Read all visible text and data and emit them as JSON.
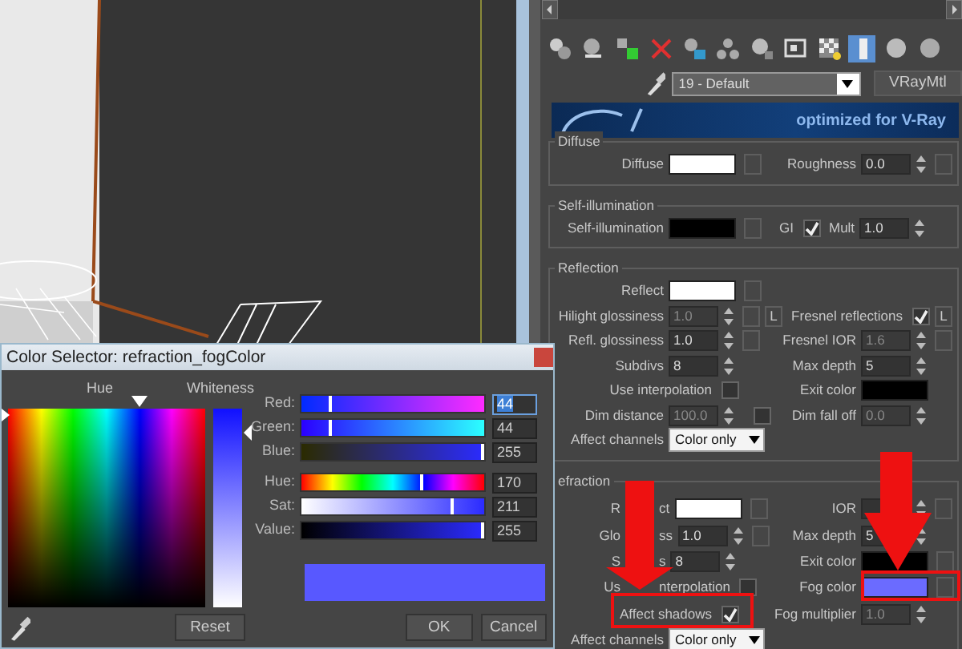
{
  "material_editor": {
    "toolbar": [
      {
        "active": false
      },
      {
        "active": false
      },
      {
        "active": false
      },
      {
        "active": false
      },
      {
        "active": false
      },
      {
        "active": false
      },
      {
        "active": false
      },
      {
        "active": false
      },
      {
        "active": false
      },
      {
        "active": true
      },
      {
        "active": false
      },
      {
        "active": false
      }
    ],
    "material_name": "19 - Default",
    "material_type": "VRayMtl",
    "banner_text": "optimized for V-Ray",
    "groups": [
      {
        "title": "Diffuse",
        "rows": [
          {
            "left": [
              {
                "label": "Diffuse",
                "kind": "color",
                "color": "#ffffff",
                "map": true
              }
            ],
            "right": [
              {
                "label": "Roughness",
                "kind": "spinner",
                "value": "0.0",
                "map": true,
                "disabled": false
              }
            ]
          }
        ]
      },
      {
        "title": "Self-illumination",
        "rows": [
          {
            "left": [
              {
                "label": "Self-illumination",
                "kind": "color",
                "color": "#000000",
                "map": true
              }
            ],
            "right": [
              {
                "label": "GI",
                "kind": "check",
                "checked": true
              },
              {
                "label": "Mult",
                "kind": "spinner",
                "value": "1.0",
                "map": false,
                "disabled": false
              }
            ]
          }
        ]
      },
      {
        "title": "Reflection",
        "rows": [
          {
            "left": [
              {
                "label": "Reflect",
                "kind": "color",
                "color": "#ffffff",
                "map": true
              }
            ],
            "right": []
          },
          {
            "left": [
              {
                "label": "Hilight glossiness",
                "kind": "spinner",
                "value": "1.0",
                "map": true,
                "lock": "L",
                "disabled": true
              }
            ],
            "right": [
              {
                "label": "Fresnel reflections",
                "kind": "check",
                "checked": true,
                "lock": "L"
              }
            ]
          },
          {
            "left": [
              {
                "label": "Refl. glossiness",
                "kind": "spinner",
                "value": "1.0",
                "map": true,
                "disabled": false
              }
            ],
            "right": [
              {
                "label": "Fresnel IOR",
                "kind": "spinner",
                "value": "1.6",
                "map": true,
                "disabled": true
              }
            ]
          },
          {
            "left": [
              {
                "label": "Subdivs",
                "kind": "spinner",
                "value": "8",
                "map": false,
                "disabled": false
              }
            ],
            "right": [
              {
                "label": "Max depth",
                "kind": "spinner",
                "value": "5",
                "map": false,
                "disabled": false
              }
            ]
          },
          {
            "left": [
              {
                "label": "Use interpolation",
                "kind": "check",
                "checked": false
              }
            ],
            "right": [
              {
                "label": "Exit color",
                "kind": "color",
                "color": "#000000",
                "map": false
              }
            ]
          },
          {
            "left": [
              {
                "label": "Dim distance",
                "kind": "spinner",
                "value": "100.0",
                "map": false,
                "disabled": true
              },
              {
                "kind": "check",
                "checked": false
              }
            ],
            "right": [
              {
                "label": "Dim fall off",
                "kind": "spinner",
                "value": "0.0",
                "map": false,
                "disabled": true
              }
            ]
          },
          {
            "left": [
              {
                "label": "Affect channels",
                "kind": "dropdown",
                "value": "Color only"
              }
            ],
            "right": []
          }
        ]
      },
      {
        "title": "efraction",
        "rows": [
          {
            "left": [
              {
                "label": [
                  "R",
                  "ct"
                ],
                "kind": "color",
                "color": "#ffffff",
                "map": true
              }
            ],
            "right": [
              {
                "label": "IOR",
                "kind": "spinner",
                "map": true
              }
            ]
          },
          {
            "left": [
              {
                "label": [
                  "Glo",
                  "ss"
                ],
                "kind": "spinner",
                "value": "1.0",
                "map": true,
                "disabled": false
              }
            ],
            "right": [
              {
                "label": "Max depth",
                "kind": "spinner",
                "value": "5",
                "map": false,
                "disabled": false
              }
            ]
          },
          {
            "left": [
              {
                "label": [
                  "S",
                  "s"
                ],
                "kind": "spinner",
                "value": "8",
                "map": false,
                "disabled": false
              }
            ],
            "right": [
              {
                "label": "Exit color",
                "kind": "color",
                "color": "#000000",
                "map": true
              }
            ]
          },
          {
            "left": [
              {
                "label": [
                  "Us",
                  "nterpolation"
                ],
                "kind": "check",
                "checked": false
              }
            ],
            "right": [
              {
                "label": "Fog color",
                "kind": "color",
                "color": "#6b6bff",
                "map": true
              }
            ]
          },
          {
            "left": [
              {
                "label": "Affect shadows",
                "kind": "check",
                "checked": true
              }
            ],
            "right": [
              {
                "label": "Fog multiplier",
                "kind": "spinner",
                "value": "1.0",
                "map": false,
                "disabled": true
              }
            ]
          },
          {
            "left": [
              {
                "label": "Affect channels",
                "kind": "dropdown",
                "value": "Color only"
              }
            ],
            "right": []
          }
        ]
      }
    ]
  },
  "color_selector": {
    "title": "Color Selector: refraction_fogColor",
    "hue_label": "Hue",
    "whiteness": {
      "label": "Whiteness",
      "level": 0.12
    },
    "sliders": [
      {
        "label": "Red:",
        "kind": "red",
        "value": "44",
        "level": 0.17,
        "focused": true
      },
      {
        "label": "Green:",
        "kind": "green",
        "value": "44",
        "level": 0.17,
        "focused": false
      },
      {
        "label": "Blue:",
        "kind": "blue",
        "value": "255",
        "level": 1,
        "focused": false
      },
      {
        "label": "Hue:",
        "kind": "hue",
        "value": "170",
        "level": 0.67,
        "focused": false
      },
      {
        "label": "Sat:",
        "kind": "sat",
        "value": "211",
        "level": 0.83,
        "focused": false
      },
      {
        "label": "Value:",
        "kind": "value",
        "value": "255",
        "level": 1,
        "focused": false
      }
    ],
    "buttons": [
      "Reset",
      "OK",
      "Cancel"
    ]
  }
}
